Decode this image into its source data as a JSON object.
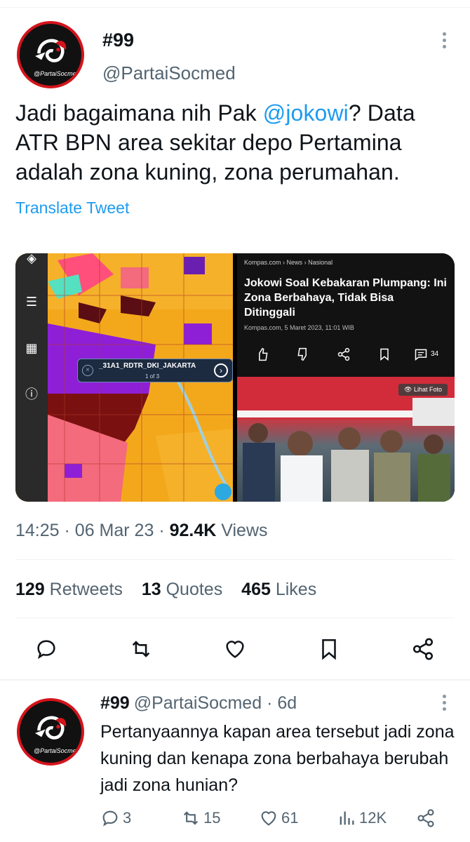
{
  "tweet": {
    "display_name": "#99",
    "username": "@PartaiSocmed",
    "avatar_caption": "@PartaiSocmed",
    "text_before": "Jadi bagaimana nih Pak ",
    "mention": "@jokowi",
    "text_after": "? Data ATR BPN area sekitar depo Pertamina adalah zona kuning, zona perumahan.",
    "translate_label": "Translate Tweet",
    "time": "14:25",
    "date": "06 Mar 23",
    "views_count": "92.4K",
    "views_label": "Views",
    "stats": [
      {
        "count": "129",
        "label": "Retweets"
      },
      {
        "count": "13",
        "label": "Quotes"
      },
      {
        "count": "465",
        "label": "Likes"
      }
    ]
  },
  "media": {
    "map_popup_title": "_31A1_RDTR_DKI_JAKARTA",
    "map_popup_page": "1 of 3",
    "news_breadcrumb": [
      "Kompas.com",
      "News",
      "Nasional"
    ],
    "news_title": "Jokowi Soal Kebakaran Plumpang: Ini Zona Berbahaya, Tidak Bisa Ditinggali",
    "news_date": "Kompas.com, 5 Maret 2023, 11:01 WIB",
    "news_comment_count": "34",
    "photo_button": "Lihat Foto"
  },
  "reply": {
    "display_name": "#99",
    "username": "@PartaiSocmed",
    "separator": "·",
    "age": "6d",
    "text": "Pertanyaannya kapan area tersebut jadi zona kuning dan kenapa zona berbahaya berubah jadi zona hunian?",
    "replies": "3",
    "retweets": "15",
    "likes": "61",
    "views": "12K"
  },
  "icons": [
    "reply-icon",
    "retweet-icon",
    "like-icon",
    "bookmark-icon",
    "share-icon",
    "views-icon",
    "more-icon"
  ],
  "colors": {
    "link": "#1d9bf0",
    "secondary_text": "#536471",
    "primary_text": "#0f1419",
    "avatar_ring": "#d4141c"
  }
}
